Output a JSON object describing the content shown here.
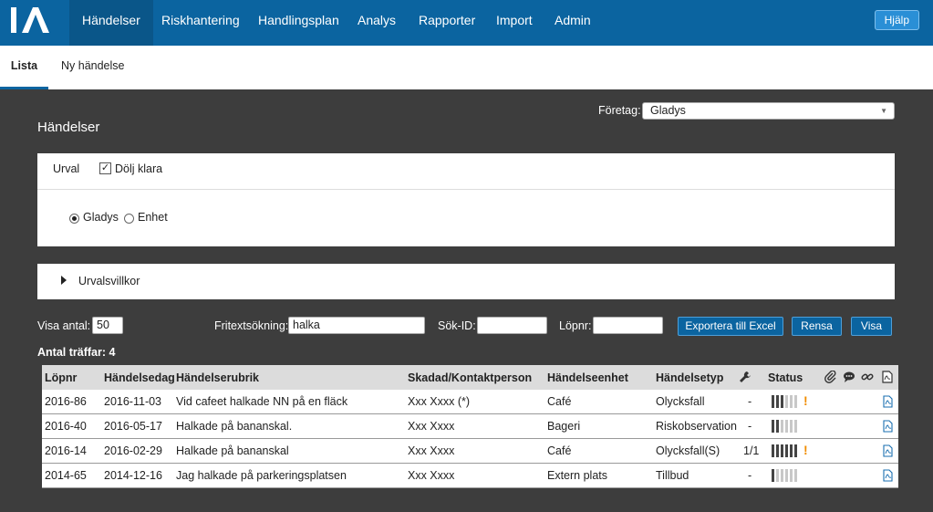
{
  "nav": {
    "logo_text": "IA",
    "items": [
      "Händelser",
      "Riskhantering",
      "Handlingsplan",
      "Analys",
      "Rapporter",
      "Import",
      "Admin"
    ],
    "help_label": "Hjälp"
  },
  "subtabs": [
    "Lista",
    "Ny händelse"
  ],
  "page_title": "Händelser",
  "company": {
    "label": "Företag:",
    "value": "Gladys"
  },
  "urval": {
    "label": "Urval",
    "hide_done_label": "Dölj klara",
    "hide_done_checked": true,
    "radios": [
      {
        "label": "Gladys",
        "checked": true
      },
      {
        "label": "Enhet",
        "checked": false
      }
    ]
  },
  "villkor_label": "Urvalsvillkor",
  "filters": {
    "count_label": "Visa antal:",
    "count_value": "50",
    "freetext_label": "Fritextsökning:",
    "freetext_value": "halka",
    "searchid_label": "Sök-ID:",
    "searchid_value": "",
    "lopnr_label": "Löpnr:",
    "lopnr_value": "",
    "export_label": "Exportera till Excel",
    "clear_label": "Rensa",
    "show_label": "Visa"
  },
  "hits_label": "Antal träffar: 4",
  "table": {
    "headers": [
      "Löpnr",
      "Händelsedag",
      "Händelserubrik",
      "Skadad/Kontaktperson",
      "Händelseenhet",
      "Händelsetyp",
      "Status"
    ],
    "rows": [
      {
        "lopnr": "2016-86",
        "date": "2016-11-03",
        "title": "Vid cafeet halkade NN på en fläck",
        "person": "Xxx Xxxx (*)",
        "unit": "Café",
        "type": "Olycksfall",
        "tool": "-",
        "status": 3,
        "alert": true
      },
      {
        "lopnr": "2016-40",
        "date": "2016-05-17",
        "title": "Halkade på bananskal.",
        "person": "Xxx Xxxx",
        "unit": "Bageri",
        "type": "Riskobservation",
        "tool": "-",
        "status": 2,
        "alert": false
      },
      {
        "lopnr": "2016-14",
        "date": "2016-02-29",
        "title": "Halkade på bananskal",
        "person": "Xxx Xxxx",
        "unit": "Café",
        "type": "Olycksfall(S)",
        "tool": "1/1",
        "status": 6,
        "alert": true
      },
      {
        "lopnr": "2014-65",
        "date": "2014-12-16",
        "title": "Jag halkade på parkeringsplatsen",
        "person": "Xxx Xxxx",
        "unit": "Extern plats",
        "type": "Tillbud",
        "tool": "-",
        "status": 1,
        "alert": false
      }
    ]
  },
  "colors": {
    "brand": "#0b64a0",
    "background": "#3d3d3d",
    "alert": "#f08c00"
  }
}
